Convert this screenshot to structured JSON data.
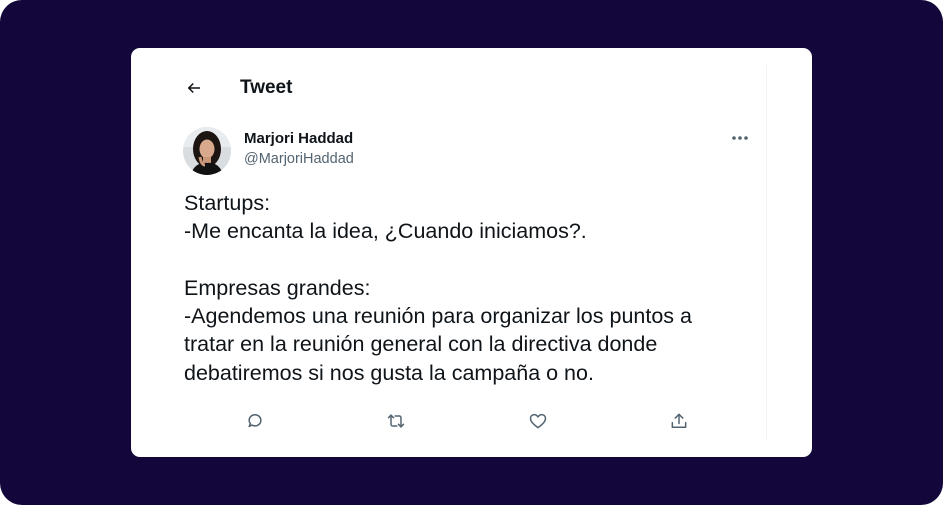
{
  "colors": {
    "background": "#13063a",
    "card": "#ffffff",
    "text_primary": "#0f1419",
    "text_secondary": "#536471"
  },
  "header": {
    "back_icon": "arrow-left-icon",
    "title": "Tweet"
  },
  "author": {
    "display_name": "Marjori Haddad",
    "handle": "@MarjoriHaddad",
    "avatar": "avatar-photo"
  },
  "more_icon": "more-horizontal-icon",
  "tweet": {
    "text": "Startups:\n-Me encanta la idea, ¿Cuando iniciamos?.\n\nEmpresas grandes:\n-Agendemos una reunión para organizar los puntos a tratar en la reunión general con la directiva donde debatiremos si nos gusta la campaña o no."
  },
  "actions": [
    {
      "name": "reply",
      "icon": "reply-icon"
    },
    {
      "name": "retweet",
      "icon": "retweet-icon"
    },
    {
      "name": "like",
      "icon": "heart-icon"
    },
    {
      "name": "share",
      "icon": "share-icon"
    }
  ]
}
